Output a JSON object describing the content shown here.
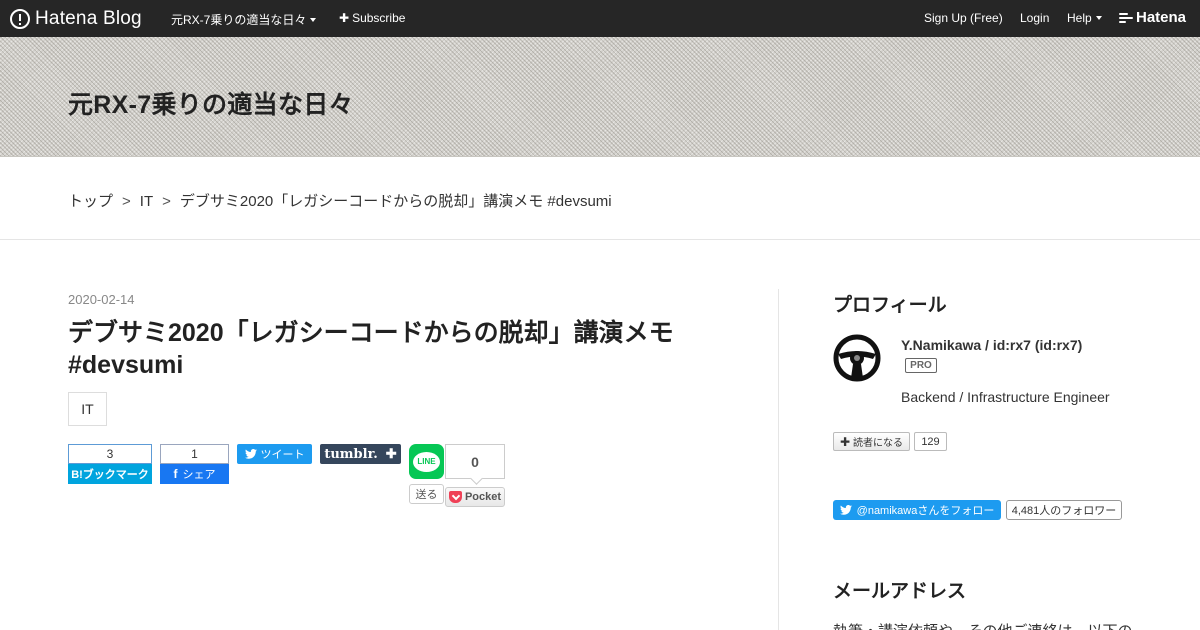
{
  "topbar": {
    "logo_text": "Hatena Blog",
    "blog_menu": "元RX-7乗りの適当な日々",
    "subscribe": "Subscribe",
    "signup": "Sign Up (Free)",
    "login": "Login",
    "help": "Help",
    "hatena": "Hatena"
  },
  "header": {
    "blog_title": "元RX-7乗りの適当な日々"
  },
  "breadcrumb": {
    "items": [
      "トップ",
      "IT",
      "デブサミ2020「レガシーコードからの脱却」講演メモ #devsumi"
    ],
    "separator": ">"
  },
  "entry": {
    "date": "2020-02-14",
    "title": "デブサミ2020「レガシーコードからの脱却」講演メモ #devsumi",
    "category": "IT"
  },
  "share": {
    "hatebu_count": "3",
    "hatebu_label": "B!ブックマーク",
    "facebook_count": "1",
    "facebook_label": "シェア",
    "tweet_label": "ツイート",
    "tumblr_label": "tumblr.",
    "line_label": "LINE",
    "line_send": "送る",
    "pocket_count": "0",
    "pocket_label": "Pocket"
  },
  "sidebar": {
    "profile_heading": "プロフィール",
    "profile_name": "Y.Namikawa / id:rx7 (id:rx7)",
    "pro_badge": "PRO",
    "profile_desc": "Backend / Infrastructure Engineer",
    "reader_label": "読者になる",
    "reader_count": "129",
    "follow_label": "@namikawaさんをフォロー",
    "follower_count": "4,481人のフォロワー",
    "mail_heading": "メールアドレス",
    "mail_text": "執筆・講演依頼や、その他ご連絡は、以下の"
  },
  "colors": {
    "topbar": "#262626",
    "hatebu": "#00a4de",
    "facebook": "#1877f2",
    "twitter": "#1d9bf0",
    "tumblr": "#35465c",
    "line": "#06c755",
    "pocket": "#ef4056"
  },
  "icons": {
    "logo": "hatena-blog-logo-icon",
    "twitter": "twitter-bird-icon",
    "pocket": "pocket-icon",
    "avatar": "steering-wheel-avatar"
  }
}
